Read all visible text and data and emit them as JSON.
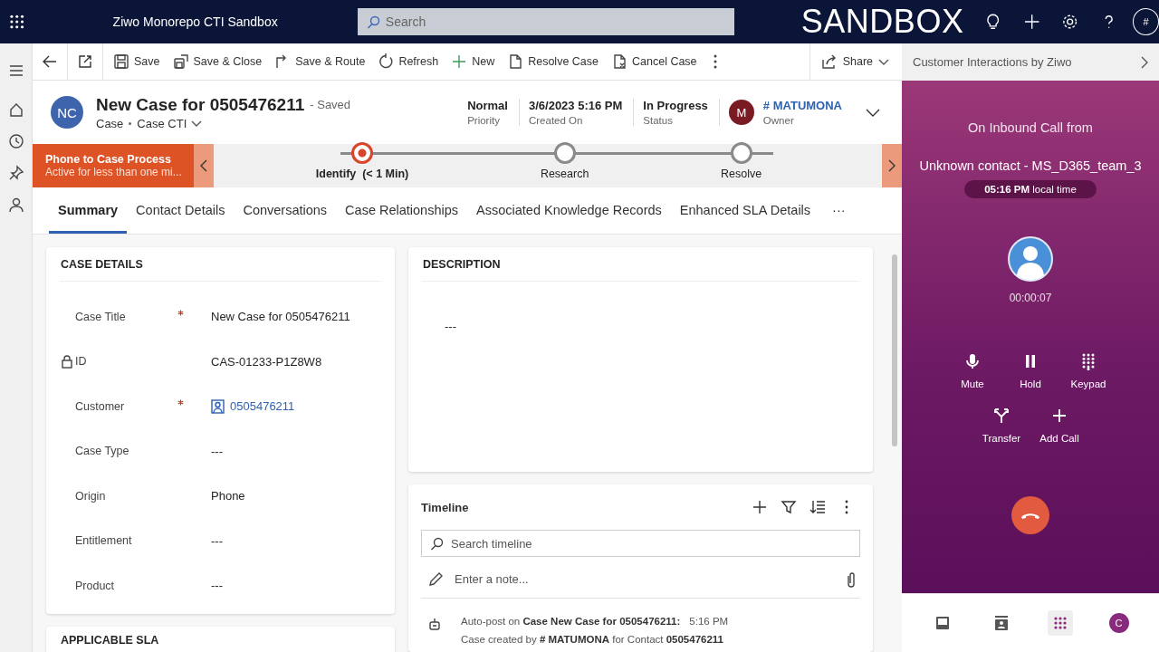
{
  "top_bar": {
    "app_title": "Ziwo Monorepo CTI Sandbox",
    "search_placeholder": "Search",
    "environment": "SANDBOX",
    "user_initial": "#"
  },
  "command_bar": {
    "items": [
      {
        "label": "Save"
      },
      {
        "label": "Save & Close"
      },
      {
        "label": "Save & Route"
      },
      {
        "label": "Refresh"
      },
      {
        "label": "New"
      },
      {
        "label": "Resolve Case"
      },
      {
        "label": "Cancel Case"
      }
    ],
    "share": "Share"
  },
  "header": {
    "initials": "NC",
    "title": "New Case for 0505476211",
    "saved_status": "- Saved",
    "entity": "Case",
    "form": "Case CTI",
    "fields": [
      {
        "value": "Normal",
        "label": "Priority"
      },
      {
        "value": "3/6/2023 5:16 PM",
        "label": "Created On"
      },
      {
        "value": "In Progress",
        "label": "Status"
      }
    ],
    "owner": {
      "initial": "M",
      "name": "# MATUMONA",
      "label": "Owner"
    }
  },
  "process": {
    "name": "Phone to Case Process",
    "subtitle": "Active for less than one mi...",
    "stages": [
      {
        "label": "Identify",
        "duration": "(< 1 Min)",
        "selected": true
      },
      {
        "label": "Research",
        "selected": false
      },
      {
        "label": "Resolve",
        "selected": false
      }
    ]
  },
  "tabs": [
    {
      "label": "Summary",
      "selected": true
    },
    {
      "label": "Contact Details",
      "selected": false
    },
    {
      "label": "Conversations",
      "selected": false
    },
    {
      "label": "Case Relationships",
      "selected": false
    },
    {
      "label": "Associated Knowledge Records",
      "selected": false
    },
    {
      "label": "Enhanced SLA Details",
      "selected": false
    }
  ],
  "tabs_overflow": "···",
  "case_details": {
    "title": "CASE DETAILS",
    "fields": [
      {
        "label": "Case Title",
        "required": true,
        "locked": false,
        "kind": "text",
        "value": "New Case for 0505476211"
      },
      {
        "label": "ID",
        "required": false,
        "locked": true,
        "kind": "text",
        "value": "CAS-01233-P1Z8W8"
      },
      {
        "label": "Customer",
        "required": true,
        "locked": false,
        "kind": "link",
        "value": "0505476211"
      },
      {
        "label": "Case Type",
        "required": false,
        "locked": false,
        "kind": "text",
        "value": "---"
      },
      {
        "label": "Origin",
        "required": false,
        "locked": false,
        "kind": "text",
        "value": "Phone"
      },
      {
        "label": "Entitlement",
        "required": false,
        "locked": false,
        "kind": "text",
        "value": "---"
      },
      {
        "label": "Product",
        "required": false,
        "locked": false,
        "kind": "text",
        "value": "---"
      }
    ]
  },
  "next_section": {
    "title": "APPLICABLE SLA"
  },
  "description": {
    "title": "DESCRIPTION",
    "value": "---"
  },
  "timeline": {
    "title": "Timeline",
    "search_placeholder": "Search timeline",
    "note_placeholder": "Enter a note...",
    "entries": [
      {
        "headline": "Auto-post on **Case New Case for 0505476211:**",
        "time": "5:16 PM",
        "detail": "Case created by **# MATUMONA** for Contact **0505476211**"
      }
    ]
  },
  "side_panel": {
    "title": "Customer Interactions by Ziwo",
    "call": {
      "heading": "On Inbound Call from",
      "contact": "Unknown contact - MS_D365_team_3",
      "local_time": "**05:16 PM** local time",
      "duration": "00:00:07",
      "controls": [
        {
          "label": "Mute"
        },
        {
          "label": "Hold"
        },
        {
          "label": "Keypad"
        },
        {
          "label": "Transfer"
        },
        {
          "label": "Add Call"
        }
      ]
    },
    "nav": [
      {
        "selected": false
      },
      {
        "selected": false
      },
      {
        "selected": true
      },
      {
        "selected": false,
        "initial": "C"
      }
    ]
  }
}
